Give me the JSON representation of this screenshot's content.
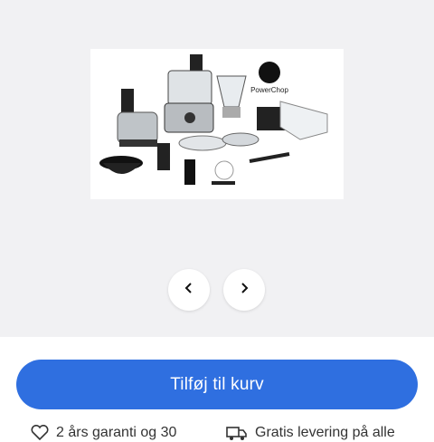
{
  "product": {
    "image_alt": "Food processor set",
    "logo_text": "PowerChop"
  },
  "gallery": {
    "prev_icon": "chevron-left-icon",
    "next_icon": "chevron-right-icon"
  },
  "cart": {
    "add_label": "Tilføj til kurv",
    "color": "#2f6fe0"
  },
  "usps": {
    "warranty": {
      "icon": "heart-icon",
      "text": "2 års garanti og 30"
    },
    "delivery": {
      "icon": "truck-icon",
      "text": "Gratis levering på alle"
    }
  }
}
